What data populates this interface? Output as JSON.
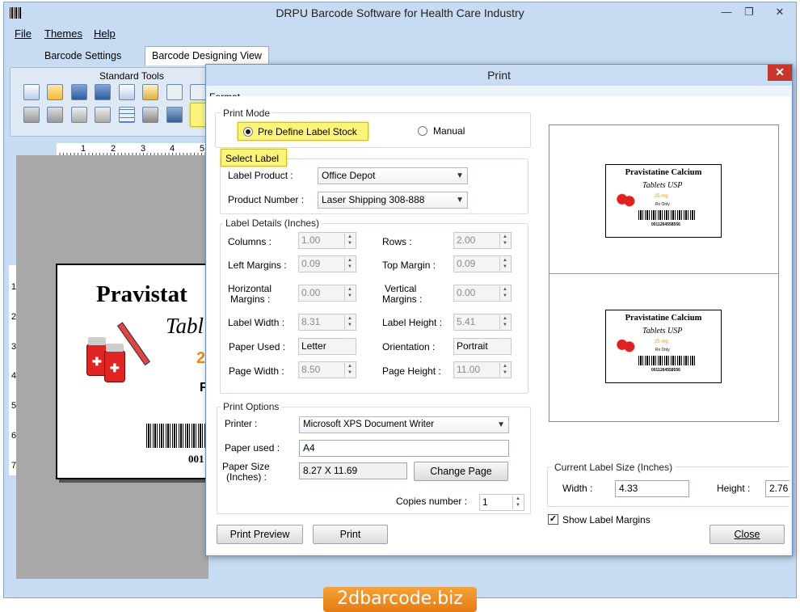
{
  "app": {
    "title": "DRPU Barcode Software for Health Care Industry",
    "window_controls": [
      "—",
      "❐",
      "✕"
    ]
  },
  "menu": [
    "File",
    "Themes",
    "Help"
  ],
  "tabs": [
    "Barcode Settings",
    "Barcode Designing View"
  ],
  "toolbar": {
    "title": "Standard Tools"
  },
  "ruler_top": [
    "1",
    "2",
    "3",
    "4",
    "5"
  ],
  "ruler_left": [
    "1",
    "2",
    "3",
    "4",
    "5",
    "6",
    "7"
  ],
  "label_preview": {
    "name": "Pravistatine Calcium",
    "line2": "Tablets USP",
    "dose": "25 mg",
    "rx": "Rx Only",
    "barcode_text": "0011264558556",
    "big_name_partial": "Pravistat",
    "big_line2_partial": "Tabl",
    "big_dose_partial": "2",
    "big_rx_partial": "F",
    "big_barcode_partial": "001"
  },
  "dialog": {
    "title": "Print",
    "close": "✕",
    "format_label": "Format",
    "print_mode": {
      "title": "Print Mode",
      "option_predefine": "Pre Define Label Stock",
      "option_manual": "Manual",
      "selected": "predefine"
    },
    "select_label": {
      "title": "Select Label",
      "product_label": "Label Product :",
      "product_value": "Office Depot",
      "number_label": "Product Number :",
      "number_value": "Laser Shipping 308-888"
    },
    "label_details": {
      "title": "Label Details (Inches)",
      "columns_label": "Columns :",
      "columns": "1.00",
      "rows_label": "Rows :",
      "rows": "2.00",
      "left_margins_label": "Left Margins :",
      "left_margins": "0.09",
      "top_margin_label": "Top Margin :",
      "top_margin": "0.09",
      "h_margins_label_1": "Horizontal",
      "h_margins_label_2": "Margins :",
      "h_margins": "0.00",
      "v_margins_label_1": "Vertical",
      "v_margins_label_2": "Margins :",
      "v_margins": "0.00",
      "label_width_label": "Label Width :",
      "label_width": "8.31",
      "label_height_label": "Label Height :",
      "label_height": "5.41",
      "paper_used_label": "Paper Used :",
      "paper_used": "Letter",
      "orientation_label": "Orientation :",
      "orientation": "Portrait",
      "page_width_label": "Page Width :",
      "page_width": "8.50",
      "page_height_label": "Page Height :",
      "page_height": "11.00"
    },
    "print_options": {
      "title": "Print Options",
      "printer_label": "Printer :",
      "printer_value": "Microsoft XPS Document Writer",
      "paper_used_label": "Paper used :",
      "paper_used_value": "A4",
      "paper_size_label_1": "Paper Size",
      "paper_size_label_2": "(Inches) :",
      "paper_size_value": "8.27 X 11.69",
      "change_page": "Change Page",
      "copies_label": "Copies number :",
      "copies_value": "1"
    },
    "current_size": {
      "title": "Current Label Size (Inches)",
      "width_label": "Width :",
      "width": "4.33",
      "height_label": "Height :",
      "height": "2.76"
    },
    "show_margins": "Show Label Margins",
    "show_margins_checked": true,
    "buttons": {
      "preview": "Print Preview",
      "print": "Print",
      "close": "Close"
    }
  },
  "footer": {
    "brand": "2dbarcode.biz"
  },
  "colors": {
    "accent_orange": "#f08a1f",
    "highlight_yellow": "#fbf37a",
    "close_red": "#c7362c"
  }
}
